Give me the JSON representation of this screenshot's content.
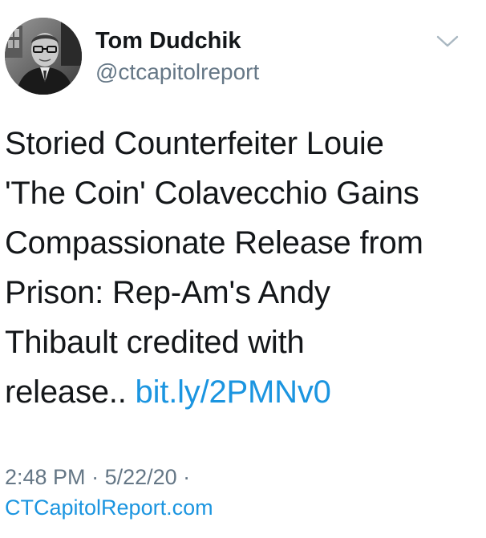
{
  "author": {
    "name": "Tom Dudchik",
    "handle": "@ctcapitolreport"
  },
  "icons": {
    "menu": "chevron-down-icon",
    "avatar": "profile-photo"
  },
  "tweet": {
    "lines": [
      "Storied Counterfeiter Louie",
      "'The Coin' Colavecchio Gains",
      "Compassionate Release from",
      "Prison: Rep-Am's Andy",
      "Thibault credited with"
    ],
    "last_line_text": "release.. ",
    "link_text": "bit.ly/2PMNv0"
  },
  "meta": {
    "time": "2:48 PM",
    "separator": " · ",
    "date": "5/22/20",
    "trailing_separator": " ·",
    "source": "CTCapitolReport.com"
  },
  "colors": {
    "text": "#14171a",
    "secondary": "#657786",
    "link": "#1b95e0",
    "background": "#ffffff"
  }
}
